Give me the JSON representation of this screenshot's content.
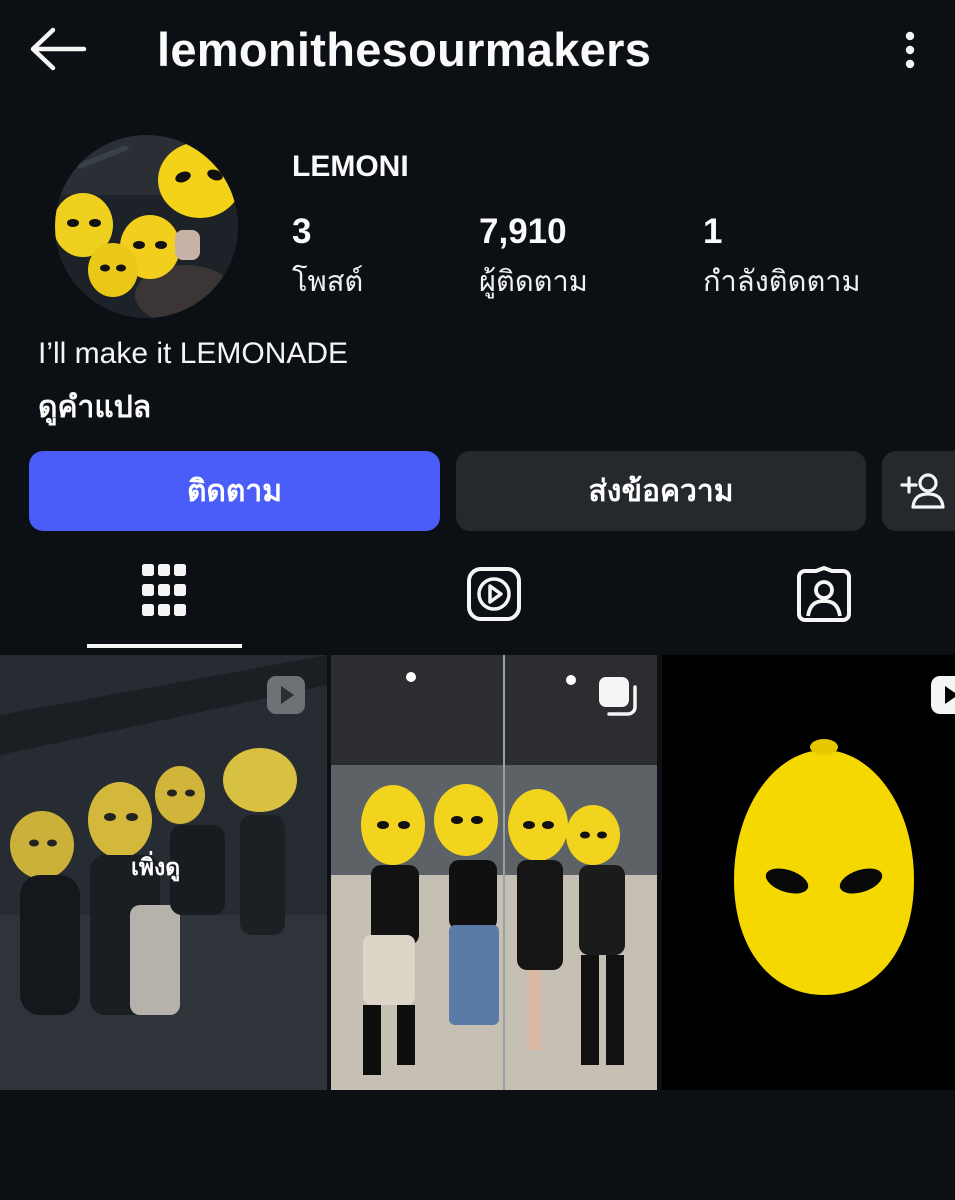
{
  "header": {
    "username": "lemonithesourmakers",
    "back_icon": "arrow-left-icon",
    "more_icon": "more-vertical-icon"
  },
  "profile": {
    "display_name": "LEMONI",
    "stats": {
      "posts": {
        "value": "3",
        "label": "โพสต์"
      },
      "followers": {
        "value": "7,910",
        "label": "ผู้ติดตาม"
      },
      "following": {
        "value": "1",
        "label": "กำลังติดตาม"
      }
    },
    "bio": "I’ll make it LEMONADE",
    "translate_label": "ดูคำแปล"
  },
  "actions": {
    "follow_label": "ติดตาม",
    "message_label": "ส่งข้อความ",
    "add_user_icon": "add-user-icon"
  },
  "tabs": [
    {
      "icon": "grid-icon",
      "active": true
    },
    {
      "icon": "reels-icon",
      "active": false
    },
    {
      "icon": "tagged-icon",
      "active": false
    }
  ],
  "posts": [
    {
      "badge": "reel-icon",
      "overlay_label": "เพิ่งดู"
    },
    {
      "badge": "carousel-icon"
    },
    {
      "badge": "reel-icon"
    }
  ],
  "colors": {
    "background": "#0c1014",
    "follow_button": "#4a5df9",
    "secondary_button": "#25292e",
    "lemon": "#f5d800"
  }
}
